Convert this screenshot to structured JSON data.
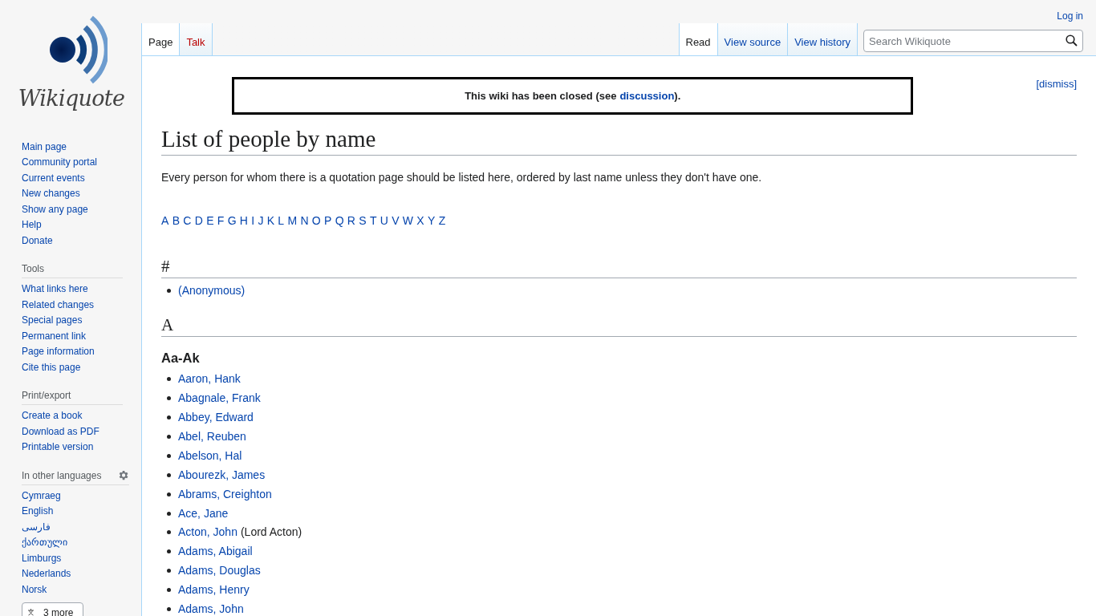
{
  "logo": {
    "wordmark": "Wikiquote"
  },
  "personal": {
    "login": "Log in"
  },
  "left_tabs": [
    {
      "label": "Page",
      "selected": true
    },
    {
      "label": "Talk",
      "selected": false,
      "missing": true
    }
  ],
  "right_tabs": [
    {
      "label": "Read",
      "selected": true
    },
    {
      "label": "View source",
      "selected": false
    },
    {
      "label": "View history",
      "selected": false
    }
  ],
  "search": {
    "placeholder": "Search Wikiquote"
  },
  "sidebar": {
    "navigation": [
      "Main page",
      "Community portal",
      "Current events",
      "New changes",
      "Show any page",
      "Help",
      "Donate"
    ],
    "portals": [
      {
        "heading": "Tools",
        "items": [
          "What links here",
          "Related changes",
          "Special pages",
          "Permanent link",
          "Page information",
          "Cite this page"
        ]
      },
      {
        "heading": "Print/export",
        "items": [
          "Create a book",
          "Download as PDF",
          "Printable version"
        ]
      },
      {
        "heading": "In other languages",
        "settings": true,
        "items": [
          "Cymraeg",
          "English",
          "فارسی",
          "ქართული",
          "Limburgs",
          "Nederlands",
          "Norsk"
        ],
        "more_button": "3 more"
      }
    ]
  },
  "notice": {
    "text": "This wiki has been closed (see",
    "link": "discussion",
    "after": ").",
    "dismiss": "[dismiss]"
  },
  "title": "List of people by name",
  "intro": "Every person for whom there is a quotation page should be listed here, ordered by last name unless they don't have one.",
  "letters": [
    "A",
    "B",
    "C",
    "D",
    "E",
    "F",
    "G",
    "H",
    "I",
    "J",
    "K",
    "L",
    "M",
    "N",
    "O",
    "P",
    "Q",
    "R",
    "S",
    "T",
    "U",
    "V",
    "W",
    "X",
    "Y",
    "Z"
  ],
  "sections": [
    {
      "heading": "#",
      "entries": [
        {
          "name": "(Anonymous)"
        }
      ]
    },
    {
      "heading": "A",
      "subsections": [
        {
          "heading": "Aa-Ak",
          "entries": [
            {
              "name": "Aaron, Hank"
            },
            {
              "name": "Abagnale, Frank"
            },
            {
              "name": "Abbey, Edward"
            },
            {
              "name": "Abel, Reuben"
            },
            {
              "name": "Abelson, Hal"
            },
            {
              "name": "Abourezk, James"
            },
            {
              "name": "Abrams, Creighton"
            },
            {
              "name": "Ace, Jane"
            },
            {
              "name": "Acton, John",
              "note": "(Lord Acton)"
            },
            {
              "name": "Adams, Abigail"
            },
            {
              "name": "Adams, Douglas"
            },
            {
              "name": "Adams, Henry"
            },
            {
              "name": "Adams, John"
            }
          ]
        }
      ]
    }
  ]
}
